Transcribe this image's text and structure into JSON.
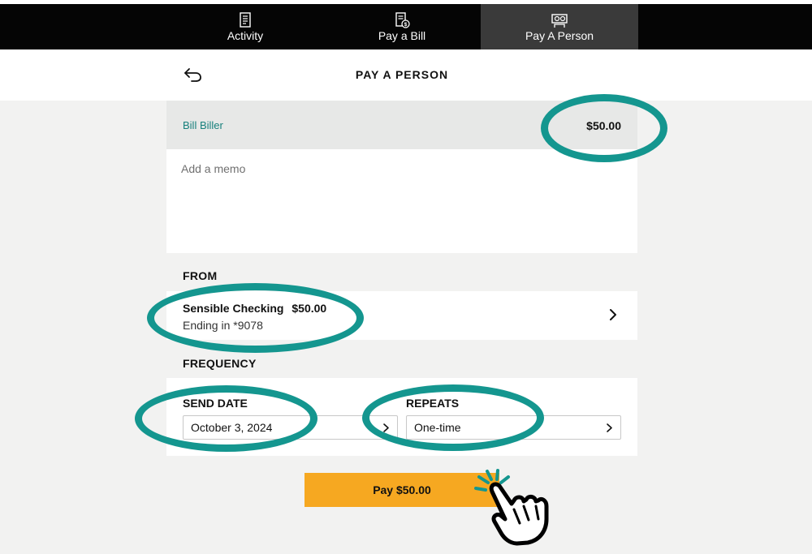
{
  "nav": {
    "tabs": [
      {
        "label": "Activity",
        "icon": "receipt-list-icon",
        "active": false
      },
      {
        "label": "Pay a Bill",
        "icon": "bill-dollar-icon",
        "active": false
      },
      {
        "label": "Pay A Person",
        "icon": "person-money-icon",
        "active": true
      }
    ]
  },
  "header": {
    "title": "PAY A PERSON",
    "back_icon": "back-arrow-icon"
  },
  "payment": {
    "payee": "Bill Biller",
    "amount": "$50.00"
  },
  "memo": {
    "placeholder": "Add a memo",
    "value": ""
  },
  "from": {
    "label": "FROM",
    "account_name": "Sensible Checking",
    "account_balance": "$50.00",
    "account_detail": "Ending in *9078"
  },
  "frequency": {
    "label": "FREQUENCY",
    "send_date_label": "SEND DATE",
    "send_date_value": "October 3, 2024",
    "repeats_label": "REPEATS",
    "repeats_value": "One-time"
  },
  "submit": {
    "label": "Pay $50.00"
  },
  "colors": {
    "accent": "#17807c",
    "callout": "#14968f",
    "button": "#f6a821",
    "nav_bg": "#050505",
    "nav_active": "#3a3a3a"
  }
}
